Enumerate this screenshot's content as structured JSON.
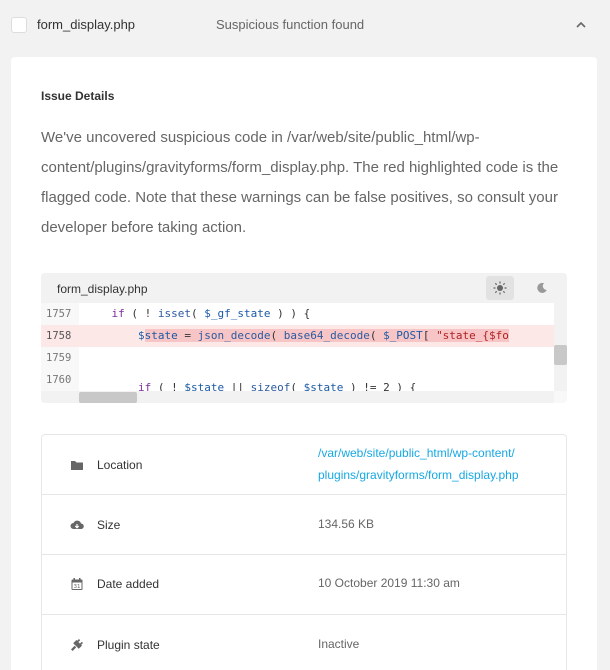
{
  "header": {
    "file_name": "form_display.php",
    "issue_summary": "Suspicious function found"
  },
  "issue": {
    "title": "Issue Details",
    "description": "We've uncovered suspicious code in /var/web/site/public_html/wp-content/plugins/gravityforms/form_display.php. The red highlighted code is the flagged code. Note that these warnings can be false positives, so consult your developer before taking action."
  },
  "code_viewer": {
    "file_name": "form_display.php",
    "theme_light": "sun-icon",
    "theme_dark": "moon-icon",
    "lines": [
      {
        "num": "1757",
        "text": "    if ( ! isset( $_gf_state ) ) {"
      },
      {
        "num": "1758",
        "text": "        $state = json_decode( base64_decode( $_POST[ \"state_{$fo"
      },
      {
        "num": "1759",
        "text": ""
      },
      {
        "num": "1760",
        "text": "        if ( ! $state || sizeof( $state ) != 2 ) {"
      }
    ]
  },
  "details": [
    {
      "icon": "folder-icon",
      "label": "Location",
      "value_line1": "/var/web/site/public_html/wp-content/",
      "value_line2": "plugins/gravityforms/form_display.php"
    },
    {
      "icon": "cloud-icon",
      "label": "Size",
      "value": "134.56 KB"
    },
    {
      "icon": "calendar-icon",
      "label": "Date added",
      "value": "10 October 2019 11:30 am"
    },
    {
      "icon": "plug-icon",
      "label": "Plugin state",
      "value": "Inactive"
    }
  ],
  "colors": {
    "link": "#17a8e3",
    "highlight": "#fde8e8",
    "highlight_mark": "#f7c5c5"
  }
}
